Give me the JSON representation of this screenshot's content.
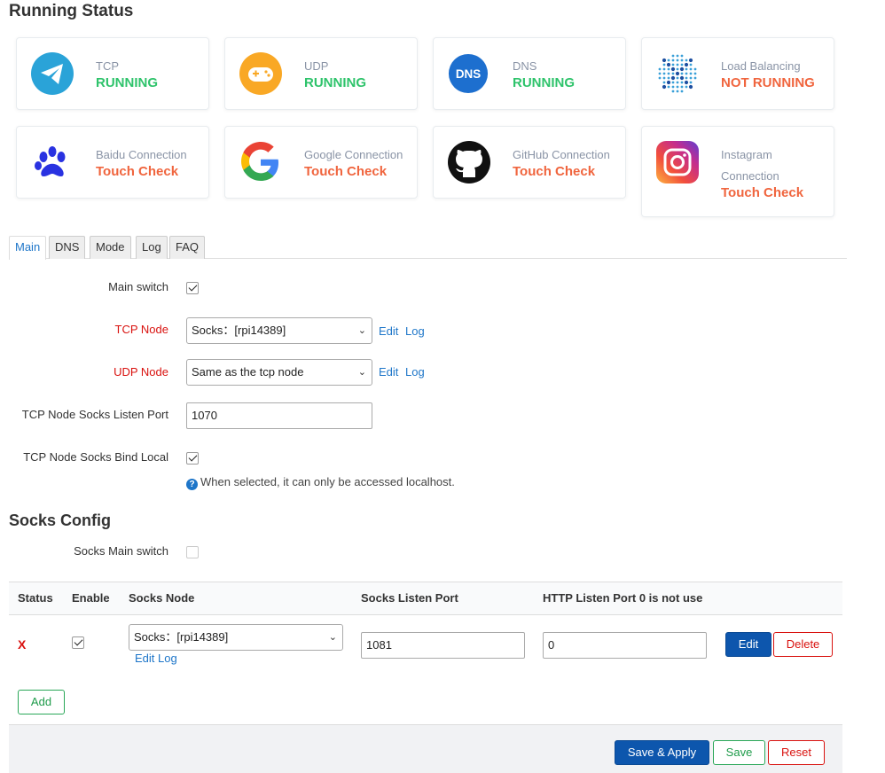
{
  "running_status": {
    "title": "Running Status",
    "cards": [
      {
        "label": "TCP",
        "value": "RUNNING",
        "status": "ok",
        "icon": "telegram-icon"
      },
      {
        "label": "UDP",
        "value": "RUNNING",
        "status": "ok",
        "icon": "gamepad-icon"
      },
      {
        "label": "DNS",
        "value": "RUNNING",
        "status": "ok",
        "icon": "dns-icon",
        "icon_text": "DNS"
      },
      {
        "label": "Load Balancing",
        "value": "NOT RUNNING",
        "status": "bad",
        "icon": "dot-grid-icon"
      },
      {
        "label": "Baidu Connection",
        "value": "Touch Check",
        "status": "bad",
        "icon": "paw-icon"
      },
      {
        "label": "Google Connection",
        "value": "Touch Check",
        "status": "bad",
        "icon": "google-icon"
      },
      {
        "label": "GitHub Connection",
        "value": "Touch Check",
        "status": "bad",
        "icon": "github-icon"
      },
      {
        "label": "Instagram Connection",
        "value": "Touch Check",
        "status": "bad",
        "icon": "instagram-icon"
      }
    ]
  },
  "tabs": [
    "Main",
    "DNS",
    "Mode",
    "Log",
    "FAQ"
  ],
  "active_tab": "Main",
  "main": {
    "main_switch_label": "Main switch",
    "main_switch_checked": true,
    "tcp_node_label": "TCP Node",
    "tcp_node_value": "Socks：[rpi14389]",
    "udp_node_label": "UDP Node",
    "udp_node_value": "Same as the tcp node",
    "edit_label": "Edit",
    "log_label": "Log",
    "socks_port_label": "TCP Node Socks Listen Port",
    "socks_port_value": "1070",
    "bind_local_label": "TCP Node Socks Bind Local",
    "bind_local_checked": true,
    "bind_local_help": "When selected, it can only be accessed localhost."
  },
  "socks_config": {
    "title": "Socks Config",
    "main_switch_label": "Socks Main switch",
    "main_switch_checked": false,
    "columns": [
      "Status",
      "Enable",
      "Socks Node",
      "Socks Listen Port",
      "HTTP Listen Port 0 is not use"
    ],
    "rows": [
      {
        "status": "X",
        "enabled": true,
        "node": "Socks：[rpi14389]",
        "edit_log": "Edit Log",
        "listen_port": "1081",
        "http_port": "0"
      }
    ],
    "row_edit_label": "Edit",
    "row_delete_label": "Delete",
    "add_label": "Add"
  },
  "footer": {
    "save_apply_label": "Save & Apply",
    "save_label": "Save",
    "reset_label": "Reset"
  },
  "colors": {
    "running": "#2ec36b",
    "not_running": "#f0653e",
    "link": "#1e76c9",
    "primary": "#0d56ad",
    "danger": "#d9120f"
  }
}
